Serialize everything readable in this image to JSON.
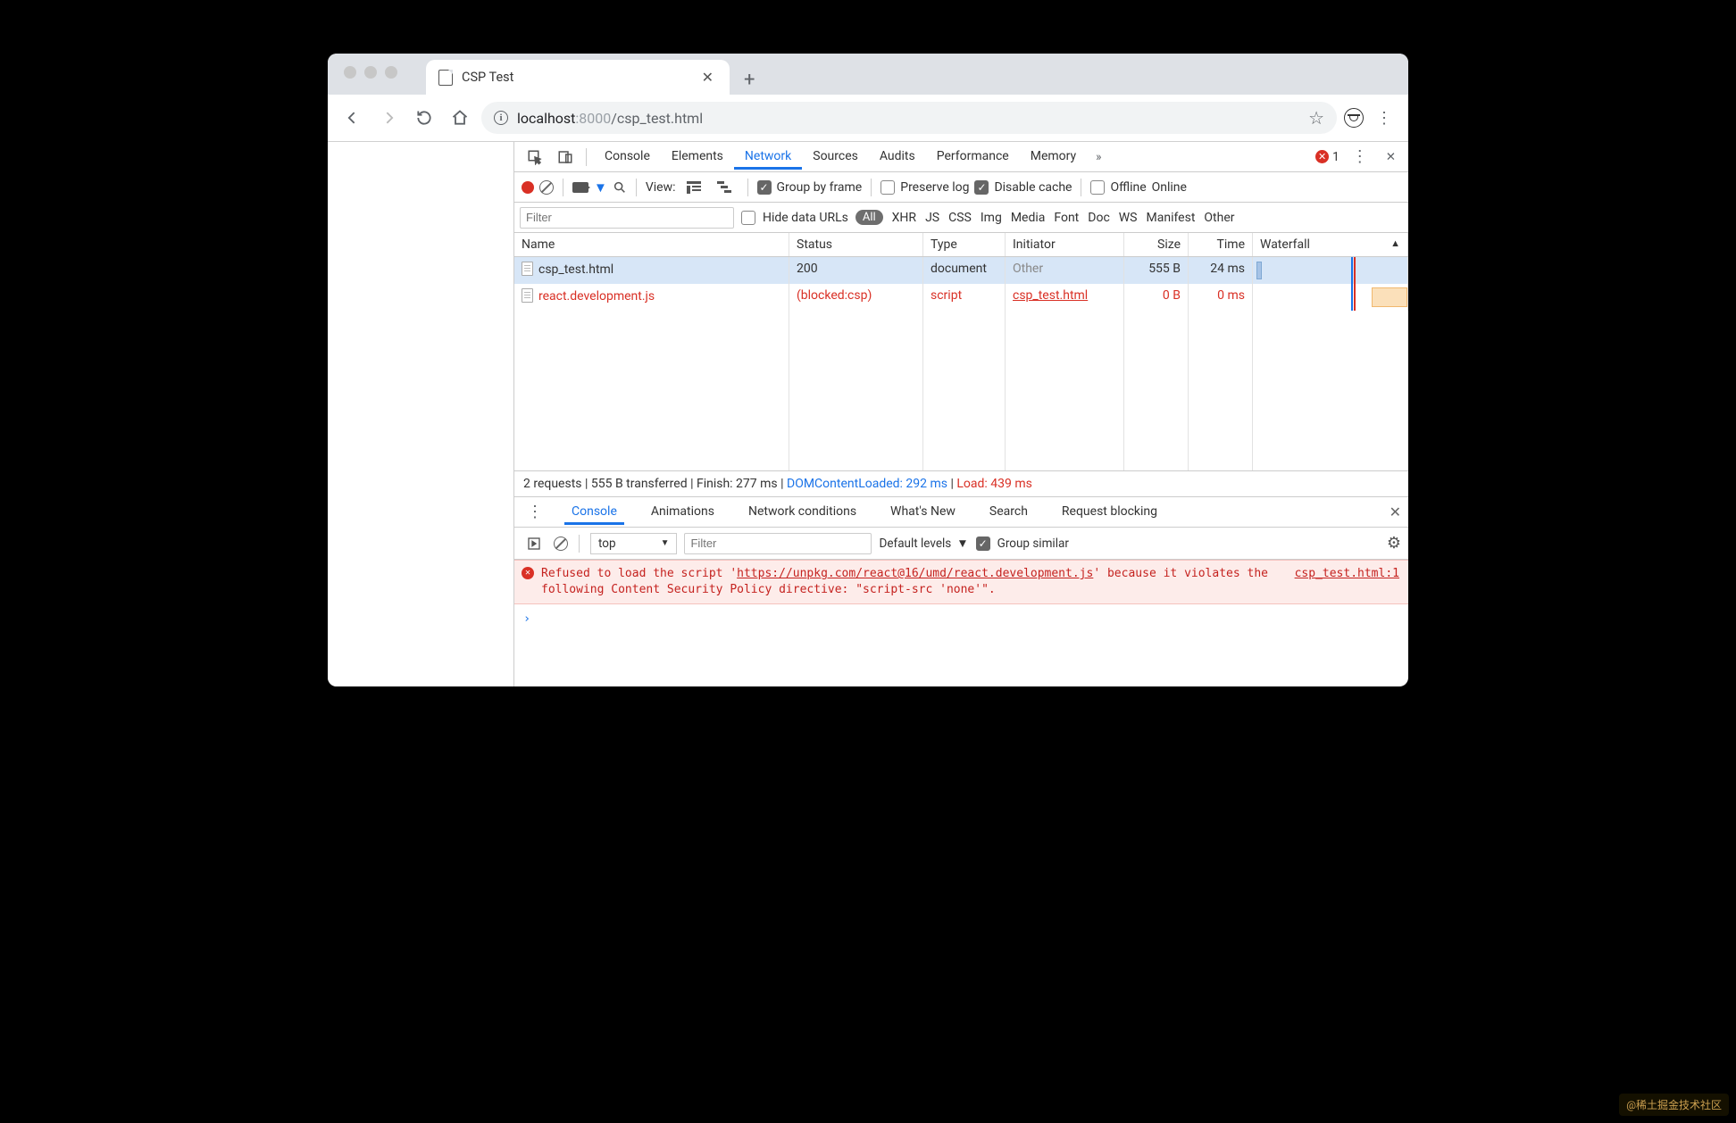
{
  "browser": {
    "tab_title": "CSP Test",
    "nav": {
      "host": "localhost",
      "port": ":8000",
      "path": "/csp_test.html"
    }
  },
  "devtools": {
    "tabs": [
      "Console",
      "Elements",
      "Network",
      "Sources",
      "Audits",
      "Performance",
      "Memory"
    ],
    "active_tab": "Network",
    "error_count": "1",
    "network_toolbar": {
      "view_label": "View:",
      "group_by_frame": "Group by frame",
      "preserve_log": "Preserve log",
      "disable_cache": "Disable cache",
      "offline": "Offline",
      "online": "Online"
    },
    "filter_row": {
      "placeholder": "Filter",
      "hide_data_urls": "Hide data URLs",
      "types": [
        "All",
        "XHR",
        "JS",
        "CSS",
        "Img",
        "Media",
        "Font",
        "Doc",
        "WS",
        "Manifest",
        "Other"
      ]
    },
    "grid_headers": {
      "name": "Name",
      "status": "Status",
      "type": "Type",
      "initiator": "Initiator",
      "size": "Size",
      "time": "Time",
      "waterfall": "Waterfall"
    },
    "requests": [
      {
        "name": "csp_test.html",
        "status": "200",
        "type": "document",
        "initiator": "Other",
        "initiator_grey": true,
        "size": "555 B",
        "time": "24 ms",
        "blocked": false,
        "selected": true
      },
      {
        "name": "react.development.js",
        "status": "(blocked:csp)",
        "type": "script",
        "initiator": "csp_test.html",
        "initiator_link": true,
        "size": "0 B",
        "time": "0 ms",
        "blocked": true,
        "selected": false
      }
    ],
    "summary": {
      "requests": "2 requests",
      "transferred": "555 B transferred",
      "finish": "Finish: 277 ms",
      "dcl": "DOMContentLoaded: 292 ms",
      "load": "Load: 439 ms"
    },
    "drawer_tabs": [
      "Console",
      "Animations",
      "Network conditions",
      "What's New",
      "Search",
      "Request blocking"
    ],
    "drawer_active": "Console",
    "console_context": {
      "context": "top",
      "filter_placeholder": "Filter",
      "levels": "Default levels",
      "group_similar": "Group similar"
    },
    "console_error": {
      "message_pre": "Refused to load the script '",
      "script_url": "https://unpkg.com/react@16/umd/react.development.js",
      "message_mid": "' because it violates the following Content Security Policy directive: \"script-src 'none'\".",
      "source": "csp_test.html:1"
    }
  },
  "watermark": "@稀土掘金技术社区"
}
